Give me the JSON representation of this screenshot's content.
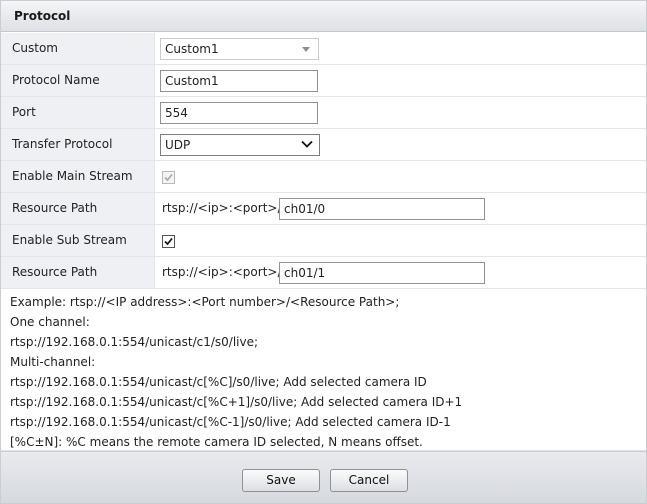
{
  "panel": {
    "title": "Protocol"
  },
  "rows": [
    {
      "label": "Custom",
      "value": "Custom1"
    },
    {
      "label": "Protocol Name",
      "value": "Custom1"
    },
    {
      "label": "Port",
      "value": "554"
    },
    {
      "label": "Transfer Protocol",
      "value": "UDP"
    },
    {
      "label": "Enable Main Stream",
      "checked": true,
      "disabled": true
    },
    {
      "label": "Resource Path",
      "prefix": "rtsp://<ip>:<port>/",
      "value": "ch01/0"
    },
    {
      "label": "Enable Sub Stream",
      "checked": true,
      "disabled": false
    },
    {
      "label": "Resource Path",
      "prefix": "rtsp://<ip>:<port>/",
      "value": "ch01/1"
    }
  ],
  "example": {
    "lines": [
      "Example:  rtsp://<IP address>:<Port number>/<Resource Path>;",
      "One channel:",
      "rtsp://192.168.0.1:554/unicast/c1/s0/live;",
      "Multi-channel:",
      "rtsp://192.168.0.1:554/unicast/c[%C]/s0/live;  Add selected camera ID",
      "rtsp://192.168.0.1:554/unicast/c[%C+1]/s0/live;  Add selected camera ID+1",
      "rtsp://192.168.0.1:554/unicast/c[%C-1]/s0/live;  Add selected camera ID-1",
      "[%C±N]:  %C means the remote camera ID selected, N means offset."
    ]
  },
  "footer": {
    "save_label": "Save",
    "cancel_label": "Cancel"
  },
  "colors": {
    "label_bg": "#eef0f3",
    "title_bg": "#dde0e5",
    "footer_bg": "#d6d9de"
  }
}
